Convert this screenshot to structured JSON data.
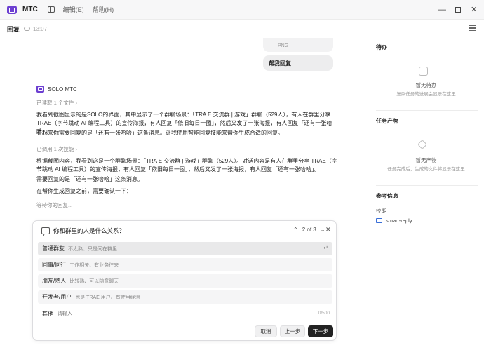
{
  "titlebar": {
    "app_title": "MTC",
    "menu_edit": "编辑(E)",
    "menu_help": "帮助(H)"
  },
  "subbar": {
    "title": "回复",
    "time": "13:07"
  },
  "chat": {
    "attachment_label": "PNG",
    "user_message": "帮我回复",
    "ai_name": "SOLO MTC",
    "read_files": "已读取 1 个文件",
    "para1": "我看到截图显示的是SOLO的界面，其中显示了一个群聊场景：「TRA E 交流群 | 游戏」群聊（529人），有人在群里分享 TRAE（字节跳动 AI 编程工具）的宣传海报，有人回复「依旧每日一图」，然后又发了一张海报，有人回复「还有一张哈哈」。",
    "para2": "看起来你需要回复的是「还有一张哈哈」这条消息。让我使用智能回复技能来帮你生成合适的回复。",
    "used_skill": "已调用 1 次技能",
    "para3": "根据截图内容，我看到这是一个群聊场景：「TRA E 交流群 | 游戏」群聊（529人）。对话内容是有人在群里分享 TRAE（字节跳动 AI 编程工具）的宣传海报，有人回复「依旧每日一图」，然后又发了一张海报，有人回复「还有一张哈哈」。",
    "para4": "需要回复的是「还有一张哈哈」这条消息。",
    "para5": "在帮你生成回复之前，需要确认一下：",
    "waiting": "等待你的回复..."
  },
  "dialog": {
    "question": "你和群里的人是什么关系？",
    "pager": "2 of 3",
    "options": [
      {
        "main": "普通群友",
        "sub": "不太熟、只是同在群里"
      },
      {
        "main": "同事/同行",
        "sub": "工作相关、有业务往来"
      },
      {
        "main": "朋友/熟人",
        "sub": "比较熟、可以随意聊天"
      },
      {
        "main": "开发者/用户",
        "sub": "也是 TRAE 用户、有使用经验"
      }
    ],
    "enter_glyph": "↵",
    "other_label": "其他",
    "other_placeholder": "请输入",
    "other_count": "0/500",
    "cancel_label": "取消",
    "prev_label": "上一步",
    "next_label": "下一步"
  },
  "sidebar": {
    "todo_header": "待办",
    "todo_title": "暂无待办",
    "todo_sub": "复杂任务的进展会显示在这里",
    "output_header": "任务产物",
    "output_title": "暂无产物",
    "output_sub": "任务完成后，生成的文件将显示在这里",
    "ref_header": "参考信息",
    "skills_label": "技能",
    "skill_name": "smart-reply"
  },
  "colors": {
    "brand": "#6c3fd1",
    "link": "#3a6fd8",
    "primary_button": "#222222"
  }
}
